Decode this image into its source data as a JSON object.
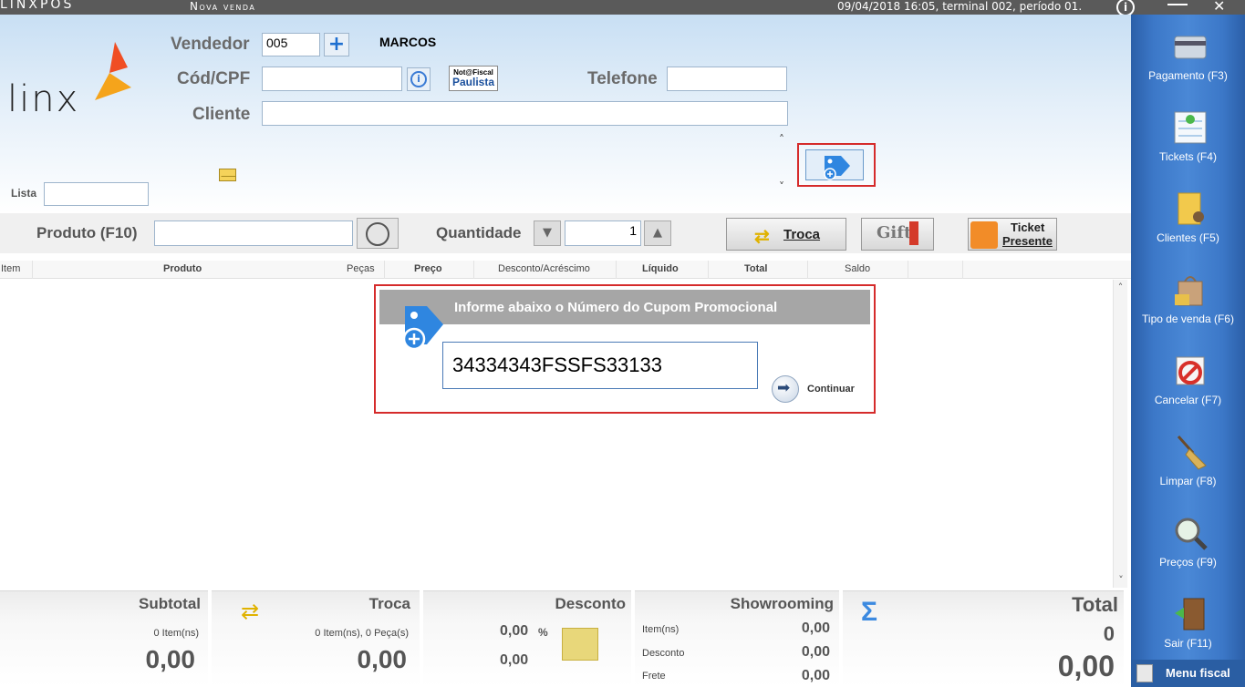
{
  "titlebar": {
    "brand": "LINXPOS",
    "title": "Nova venda",
    "status": "09/04/2018 16:05, terminal 002, período 01."
  },
  "header": {
    "logo_text": "linx",
    "vendedor_label": "Vendedor",
    "vendedor_value": "005",
    "vendedor_name": "MARCOS",
    "cpf_label": "Cód/CPF",
    "cpf_value": "",
    "nota_fiscal_line1": "Not@Fiscal",
    "nota_fiscal_line2": "Paulista",
    "telefone_label": "Telefone",
    "telefone_value": "",
    "cliente_label": "Cliente",
    "cliente_value": "",
    "lista_label": "Lista",
    "lista_value": ""
  },
  "productbar": {
    "produto_label": "Produto (F10)",
    "produto_value": "",
    "quantidade_label": "Quantidade",
    "quantidade_value": "1",
    "troca_label": "Troca",
    "gift_label": "Gift",
    "ticket_presente_line1": "Ticket",
    "ticket_presente_line2": "Presente"
  },
  "table": {
    "columns": [
      "Item",
      "Produto",
      "Peças",
      "Preço",
      "Desconto/Acréscimo",
      "Líquido",
      "Total",
      "Saldo"
    ]
  },
  "dialog": {
    "title": "Informe abaixo o Número do Cupom Promocional",
    "coupon_value": "34334343FSSFS33133",
    "continue_label": "Continuar"
  },
  "totals": {
    "subtotal": {
      "title": "Subtotal",
      "items": "0 Item(ns)",
      "value": "0,00"
    },
    "troca": {
      "title": "Troca",
      "items": "0 Item(ns), 0 Peça(s)",
      "value": "0,00"
    },
    "desconto": {
      "title": "Desconto",
      "percent": "0,00",
      "percent_sign": "%",
      "value": "0,00"
    },
    "showrooming": {
      "title": "Showrooming",
      "itens_label": "Item(ns)",
      "itens_value": "0,00",
      "desconto_label": "Desconto",
      "desconto_value": "0,00",
      "frete_label": "Frete",
      "frete_value": "0,00"
    },
    "total": {
      "title": "Total",
      "count": "0",
      "value": "0,00"
    }
  },
  "sidebar": {
    "items": [
      {
        "label": "Pagamento (F3)",
        "icon": "payment-icon"
      },
      {
        "label": "Tickets (F4)",
        "icon": "tickets-icon"
      },
      {
        "label": "Clientes (F5)",
        "icon": "clients-folder-icon"
      },
      {
        "label": "Tipo de venda (F6)",
        "icon": "shopping-bag-icon"
      },
      {
        "label": "Cancelar (F7)",
        "icon": "cancel-calendar-icon"
      },
      {
        "label": "Limpar (F8)",
        "icon": "broom-icon"
      },
      {
        "label": "Preços (F9)",
        "icon": "price-magnifier-icon"
      },
      {
        "label": "Sair (F11)",
        "icon": "exit-door-icon"
      }
    ],
    "menu_fiscal": "Menu fiscal"
  },
  "colors": {
    "highlight_border": "#d52b2b",
    "sidebar_blue": "#3c78c8",
    "tag_blue": "#2f86e0"
  }
}
